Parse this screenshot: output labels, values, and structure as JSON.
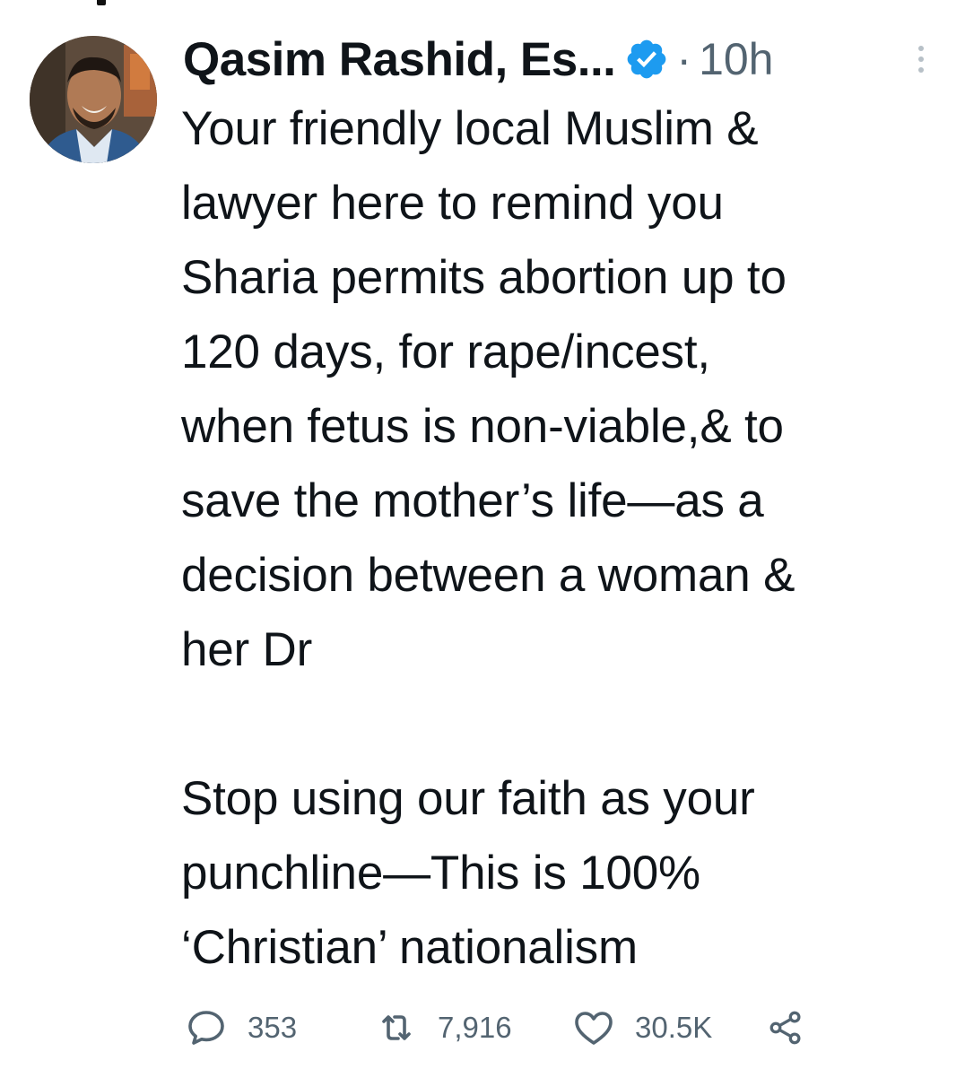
{
  "tweet": {
    "author_name": "Qasim Rashid, Es...",
    "separator": "·",
    "timestamp": "10h",
    "text": "Your friendly local Muslim &\nlawyer here to remind you\nSharia permits abortion up to\n120 days, for rape/incest,\nwhen fetus is non-viable,& to\nsave the mother’s life—as a\ndecision between a woman &\nher Dr\n\nStop using our faith as your\npunchline—This is 100%\n‘Christian’ nationalism"
  },
  "actions": {
    "replies": "353",
    "retweets": "7,916",
    "likes": "30.5K"
  },
  "icons": {
    "verified": "verified-badge-icon",
    "more": "more-vertical-icon",
    "reply": "reply-icon",
    "retweet": "retweet-icon",
    "like": "heart-icon",
    "share": "share-icon"
  },
  "colors": {
    "verified": "#1d9bf0",
    "text": "#0f1419",
    "muted": "#536471"
  }
}
